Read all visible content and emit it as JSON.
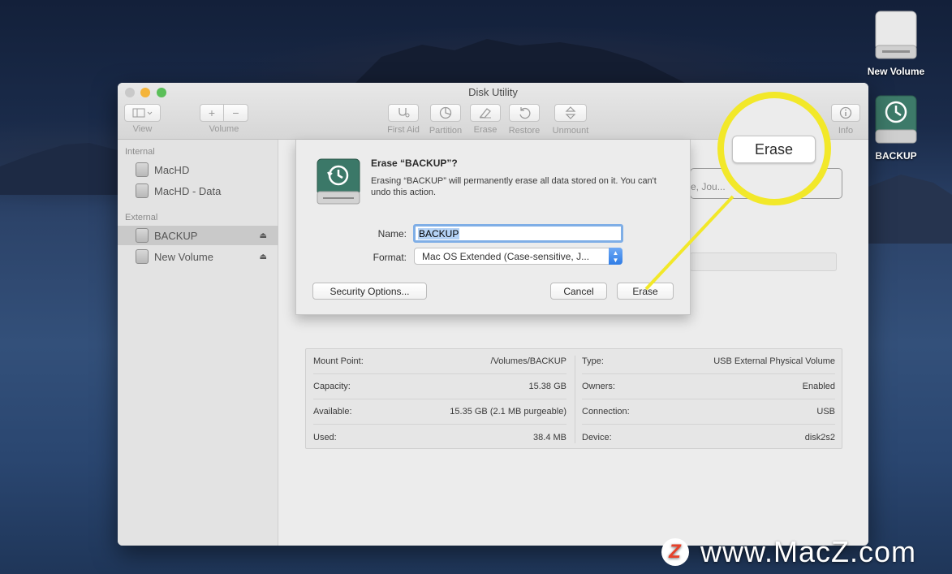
{
  "window": {
    "title": "Disk Utility"
  },
  "toolbar": {
    "view_label": "View",
    "volume_label": "Volume",
    "volume_add": "+",
    "volume_remove": "−",
    "first_aid_label": "First Aid",
    "partition_label": "Partition",
    "erase_label": "Erase",
    "restore_label": "Restore",
    "unmount_label": "Unmount",
    "info_label": "Info"
  },
  "sidebar": {
    "internal_header": "Internal",
    "external_header": "External",
    "internal_items": [
      {
        "label": "MacHD"
      },
      {
        "label": "MacHD - Data"
      }
    ],
    "external_items": [
      {
        "label": "BACKUP",
        "selected": true
      },
      {
        "label": "New Volume",
        "selected": false
      }
    ]
  },
  "background_partial": {
    "text": "e, Jou..."
  },
  "info": {
    "left": [
      {
        "label": "Mount Point:",
        "value": "/Volumes/BACKUP"
      },
      {
        "label": "Capacity:",
        "value": "15.38 GB"
      },
      {
        "label": "Available:",
        "value": "15.35 GB (2.1 MB purgeable)"
      },
      {
        "label": "Used:",
        "value": "38.4 MB"
      }
    ],
    "right": [
      {
        "label": "Type:",
        "value": "USB External Physical Volume"
      },
      {
        "label": "Owners:",
        "value": "Enabled"
      },
      {
        "label": "Connection:",
        "value": "USB"
      },
      {
        "label": "Device:",
        "value": "disk2s2"
      }
    ]
  },
  "dialog": {
    "title": "Erase “BACKUP”?",
    "message": "Erasing “BACKUP” will permanently erase all data stored on it. You can't undo this action.",
    "name_label": "Name:",
    "name_value": "BACKUP",
    "format_label": "Format:",
    "format_value": "Mac OS Extended (Case-sensitive, J...",
    "security_button": "Security Options...",
    "cancel_button": "Cancel",
    "erase_button": "Erase"
  },
  "callout": {
    "button_label": "Erase",
    "color": "#f2e829"
  },
  "desktop": {
    "icons": [
      {
        "label": "New Volume",
        "icon": "drive-icon"
      },
      {
        "label": "BACKUP",
        "icon": "time-machine-drive-icon"
      }
    ]
  },
  "watermark": {
    "logo": "Z",
    "text": "www.MacZ.com"
  }
}
